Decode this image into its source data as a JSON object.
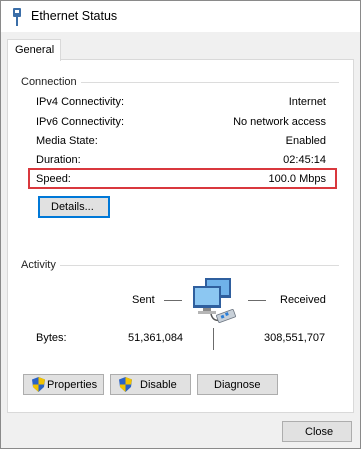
{
  "window": {
    "title": "Ethernet Status"
  },
  "tabs": [
    {
      "label": "General"
    }
  ],
  "connection": {
    "heading": "Connection",
    "rows": [
      {
        "label": "IPv4 Connectivity:",
        "value": "Internet"
      },
      {
        "label": "IPv6 Connectivity:",
        "value": "No network access"
      },
      {
        "label": "Media State:",
        "value": "Enabled"
      },
      {
        "label": "Duration:",
        "value": "02:45:14"
      },
      {
        "label": "Speed:",
        "value": "100.0 Mbps"
      }
    ],
    "details_label": "Details..."
  },
  "activity": {
    "heading": "Activity",
    "sent_label": "Sent",
    "received_label": "Received",
    "bytes_label": "Bytes:",
    "bytes_sent": "51,361,084",
    "bytes_received": "308,551,707"
  },
  "actions": {
    "properties_label": "Properties",
    "disable_label": "Disable",
    "diagnose_label": "Diagnose"
  },
  "footer": {
    "close_label": "Close"
  },
  "colors": {
    "highlight": "#d9383d",
    "focus": "#0078d7",
    "shield_blue": "#2a63c6",
    "shield_yellow": "#f2c300"
  },
  "icons": [
    "ethernet-title-icon",
    "network-computers-icon",
    "uac-shield-icon"
  ]
}
